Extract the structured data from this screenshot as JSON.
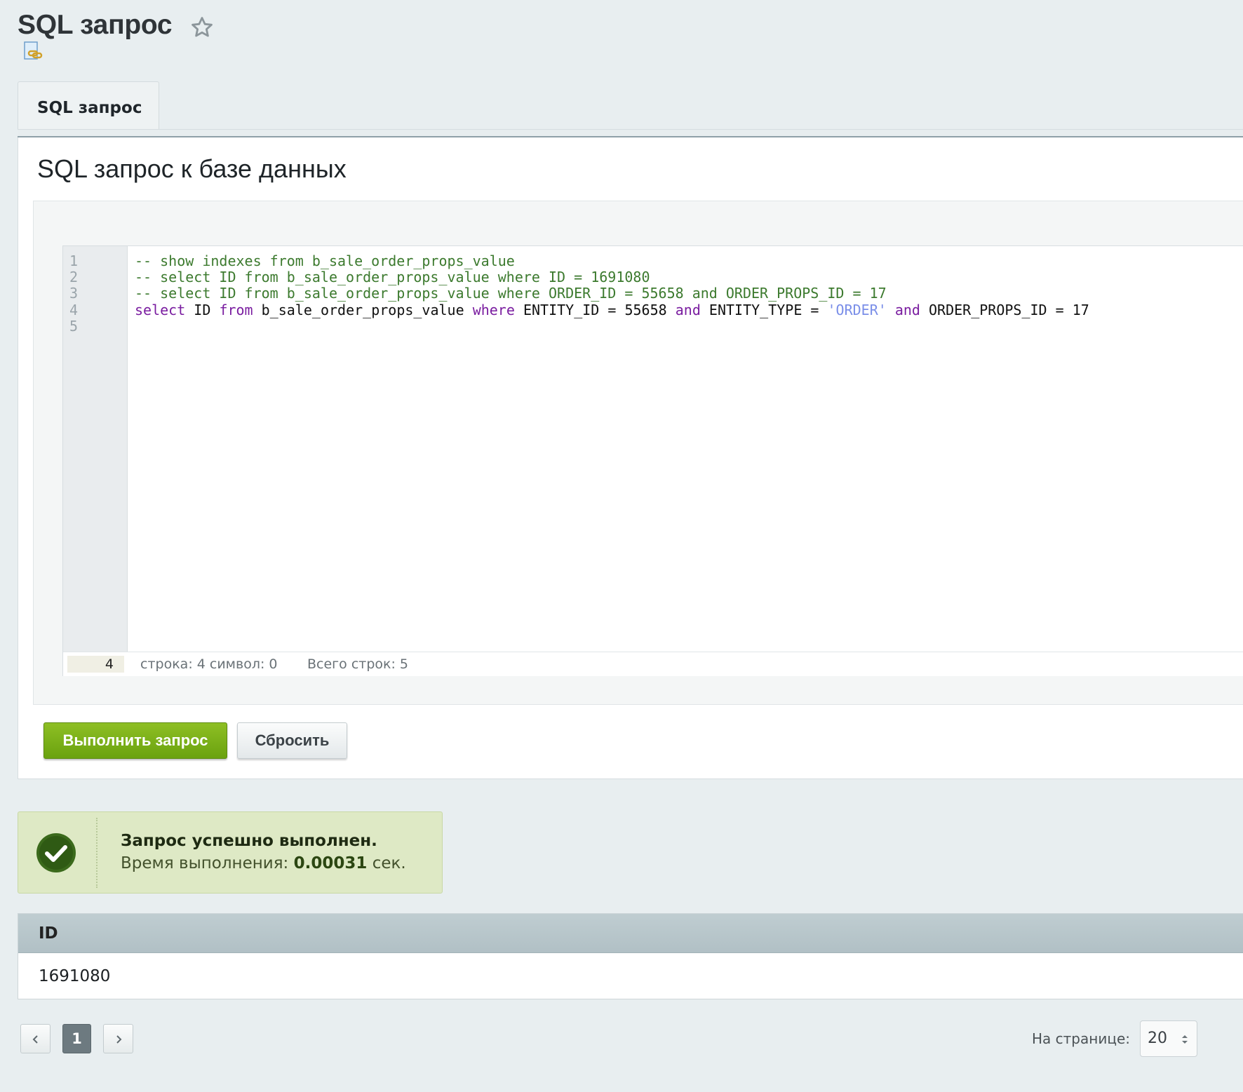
{
  "page": {
    "title": "SQL запрос",
    "icons": {
      "favorite": "star-icon",
      "link": "link-icon"
    }
  },
  "tabs": [
    {
      "label": "SQL запрос",
      "active": true
    }
  ],
  "panel": {
    "heading": "SQL запрос к базе данных"
  },
  "editor": {
    "line_numbers": [
      "1",
      "2",
      "3",
      "4",
      "5"
    ],
    "lines": [
      "-- show indexes from b_sale_order_props_value",
      "-- select ID from b_sale_order_props_value where ID = 1691080",
      "-- select ID from b_sale_order_props_value where ORDER_ID = 55658 and ORDER_PROPS_ID = 17",
      "select ID from b_sale_order_props_value where ENTITY_ID = 55658 and ENTITY_TYPE = 'ORDER' and ORDER_PROPS_ID = 17",
      ""
    ],
    "current_line": "4",
    "status_position": "строка: 4   символ: 0",
    "status_total": "Всего строк: 5",
    "colors": {
      "comment": "#3c7a2e",
      "keyword": "#7a1da0",
      "string": "#7a8ee8"
    }
  },
  "buttons": {
    "run": "Выполнить запрос",
    "reset": "Сбросить",
    "run_color": "#7ab11a"
  },
  "result_message": {
    "title": "Запрос успешно выполнен.",
    "time_label": "Время выполнения:",
    "time_value": "0.00031",
    "time_unit": "сек.",
    "icon": "check-circle-icon"
  },
  "result_table": {
    "columns": [
      "ID"
    ],
    "rows": [
      [
        "1691080"
      ]
    ]
  },
  "pagination": {
    "current_page": "1",
    "per_page_label": "На странице:",
    "per_page_value": "20"
  }
}
